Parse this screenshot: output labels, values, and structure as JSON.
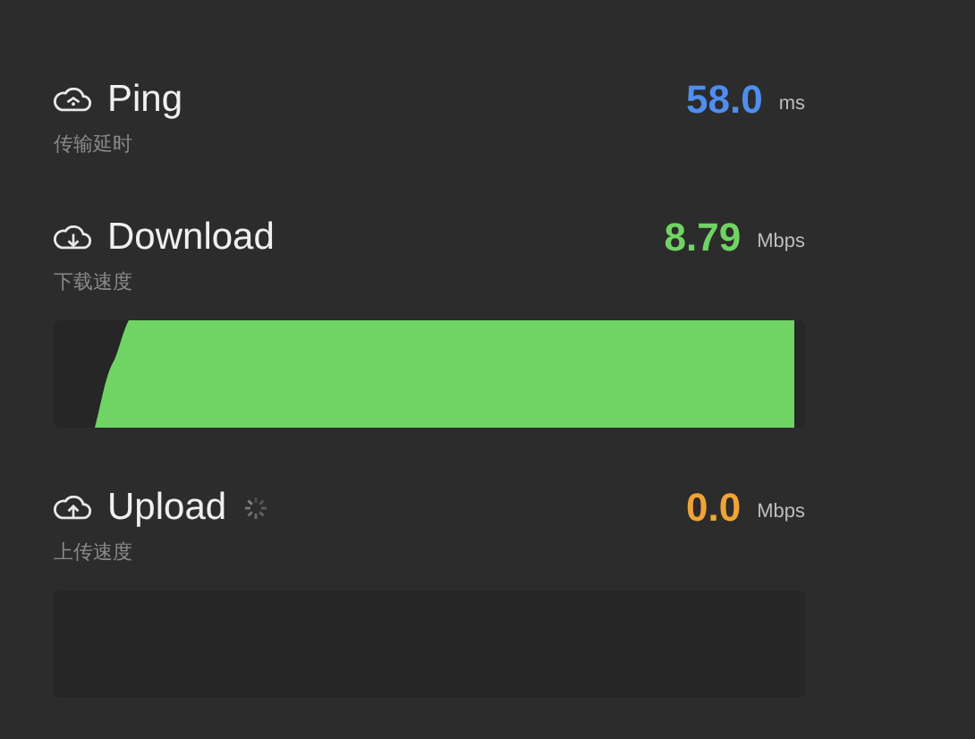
{
  "metrics": [
    {
      "kind": "ping",
      "title": "Ping",
      "subtitle": "传输延时",
      "value": "58.0",
      "unit": "ms",
      "color": "#4f8ef0",
      "loading": false
    },
    {
      "kind": "download",
      "title": "Download",
      "subtitle": "下载速度",
      "value": "8.79",
      "unit": "Mbps",
      "color": "#6fd463",
      "loading": false,
      "graph": {
        "kind": "area"
      }
    },
    {
      "kind": "upload",
      "title": "Upload",
      "subtitle": "上传速度",
      "value": "0.0",
      "unit": "Mbps",
      "color": "#f0a431",
      "loading": true,
      "graph": {
        "kind": "empty"
      }
    }
  ]
}
